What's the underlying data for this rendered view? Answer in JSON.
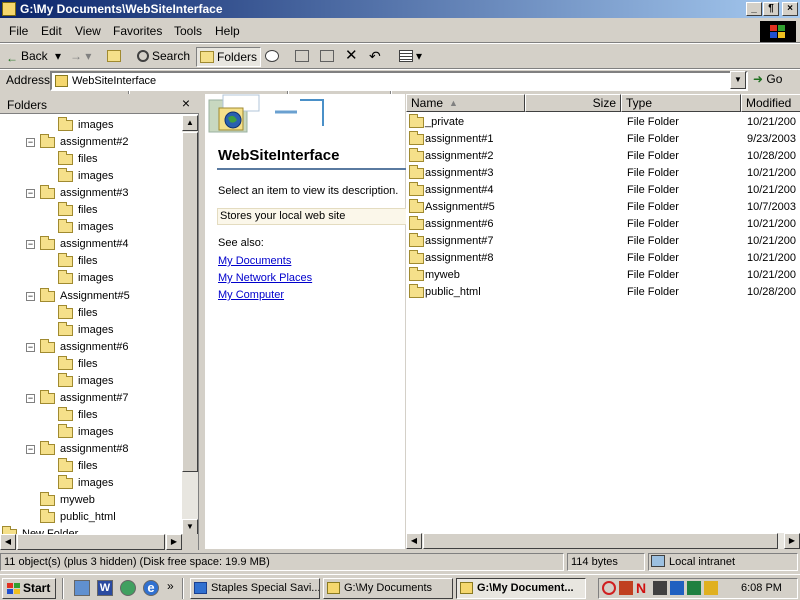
{
  "window": {
    "title": "G:\\My Documents\\WebSiteInterface",
    "controls": [
      "_",
      "¶",
      "×"
    ]
  },
  "menu": [
    "File",
    "Edit",
    "View",
    "Favorites",
    "Tools",
    "Help"
  ],
  "toolbar": {
    "back": "Back",
    "search": "Search",
    "folders": "Folders"
  },
  "address": {
    "label": "Address",
    "value": "WebSiteInterface",
    "go": "Go"
  },
  "folders_pane": {
    "title": "Folders",
    "close": "×",
    "tree": [
      {
        "label": "images",
        "level": 2,
        "expander": ""
      },
      {
        "label": "assignment#2",
        "level": 1,
        "expander": "−"
      },
      {
        "label": "files",
        "level": 2,
        "expander": ""
      },
      {
        "label": "images",
        "level": 2,
        "expander": ""
      },
      {
        "label": "assignment#3",
        "level": 1,
        "expander": "−"
      },
      {
        "label": "files",
        "level": 2,
        "expander": ""
      },
      {
        "label": "images",
        "level": 2,
        "expander": ""
      },
      {
        "label": "assignment#4",
        "level": 1,
        "expander": "−"
      },
      {
        "label": "files",
        "level": 2,
        "expander": ""
      },
      {
        "label": "images",
        "level": 2,
        "expander": ""
      },
      {
        "label": "Assignment#5",
        "level": 1,
        "expander": "−"
      },
      {
        "label": "files",
        "level": 2,
        "expander": ""
      },
      {
        "label": "images",
        "level": 2,
        "expander": ""
      },
      {
        "label": "assignment#6",
        "level": 1,
        "expander": "−"
      },
      {
        "label": "files",
        "level": 2,
        "expander": ""
      },
      {
        "label": "images",
        "level": 2,
        "expander": ""
      },
      {
        "label": "assignment#7",
        "level": 1,
        "expander": "−"
      },
      {
        "label": "files",
        "level": 2,
        "expander": ""
      },
      {
        "label": "images",
        "level": 2,
        "expander": ""
      },
      {
        "label": "assignment#8",
        "level": 1,
        "expander": "−"
      },
      {
        "label": "files",
        "level": 2,
        "expander": ""
      },
      {
        "label": "images",
        "level": 2,
        "expander": ""
      },
      {
        "label": "myweb",
        "level": 1,
        "expander": ""
      },
      {
        "label": "public_html",
        "level": 1,
        "expander": ""
      },
      {
        "label": "New Folder",
        "level": 0,
        "expander": ""
      }
    ]
  },
  "info_pane": {
    "title": "WebSiteInterface",
    "hint": "Select an item to view its description.",
    "description": "Stores your local web site",
    "see_also": "See also:",
    "links": [
      "My Documents",
      "My Network Places",
      "My Computer"
    ]
  },
  "file_list": {
    "columns": [
      "Name",
      "Size",
      "Type",
      "Modified"
    ],
    "rows": [
      {
        "name": "_private",
        "type": "File Folder",
        "modified": "10/21/200"
      },
      {
        "name": "assignment#1",
        "type": "File Folder",
        "modified": "9/23/2003"
      },
      {
        "name": "assignment#2",
        "type": "File Folder",
        "modified": "10/28/200"
      },
      {
        "name": "assignment#3",
        "type": "File Folder",
        "modified": "10/21/200"
      },
      {
        "name": "assignment#4",
        "type": "File Folder",
        "modified": "10/21/200"
      },
      {
        "name": "Assignment#5",
        "type": "File Folder",
        "modified": "10/7/2003"
      },
      {
        "name": "assignment#6",
        "type": "File Folder",
        "modified": "10/21/200"
      },
      {
        "name": "assignment#7",
        "type": "File Folder",
        "modified": "10/21/200"
      },
      {
        "name": "assignment#8",
        "type": "File Folder",
        "modified": "10/21/200"
      },
      {
        "name": "myweb",
        "type": "File Folder",
        "modified": "10/21/200"
      },
      {
        "name": "public_html",
        "type": "File Folder",
        "modified": "10/28/200"
      }
    ]
  },
  "status": {
    "objects": "11 object(s) (plus 3 hidden) (Disk free space: 19.9 MB)",
    "size": "114 bytes",
    "zone": "Local intranet"
  },
  "taskbar": {
    "start": "Start",
    "tasks": [
      {
        "label": "Staples Special Savi...",
        "active": false
      },
      {
        "label": "G:\\My Documents",
        "active": false
      },
      {
        "label": "G:\\My Document...",
        "active": true
      }
    ],
    "clock": "6:08 PM"
  }
}
